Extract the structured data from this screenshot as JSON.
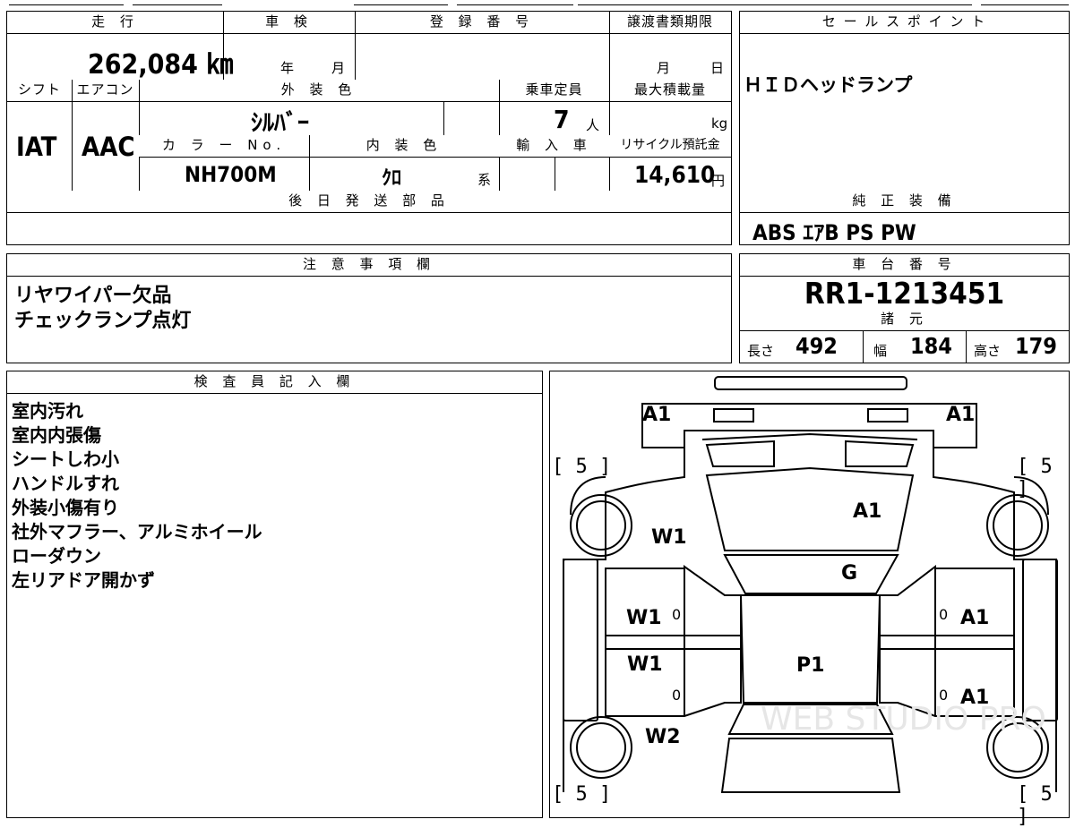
{
  "top_row": {
    "mileage_header": "走 行",
    "mileage_value": "262,084 ㎞",
    "shaken_header": "車 検",
    "shaken_year": "年",
    "shaken_month": "月",
    "reg_header": "登 録 番 号",
    "transfer_header": "譲渡書類期限",
    "transfer_month": "月",
    "transfer_day": "日"
  },
  "spec_row": {
    "shift_header": "シフト",
    "shift_value": "IAT",
    "ac_header": "エアコン",
    "ac_value": "AAC",
    "exterior_header": "外 装 色",
    "exterior_value": "ｼﾙﾊﾞｰ",
    "capacity_header": "乗車定員",
    "capacity_value": "7",
    "capacity_unit": "人",
    "loadmax_header": "最大積載量",
    "loadmax_unit": "kg",
    "colorno_header": "カ ラ ー No.",
    "colorno_value": "NH700M",
    "interior_header": "内 装 色",
    "interior_value": "ｸﾛ",
    "interior_suffix": "系",
    "import_header": "輸 入 車",
    "recycle_header": "リサイクル預託金",
    "recycle_value": "14,610",
    "recycle_unit": "円",
    "later_parts_header": "後 日 発 送 部 品"
  },
  "sales_point": {
    "header": "セ ー ル ス ポ イ ン ト",
    "text": "ＨＩＤヘッドランプ"
  },
  "genuine": {
    "header": "純 正 装 備",
    "text": "ABS ｴｱB PS PW"
  },
  "notes": {
    "header": "注 意 事 項 欄",
    "lines": [
      "リヤワイパー欠品",
      "チェックランプ点灯"
    ]
  },
  "chassis": {
    "header": "車 台 番 号",
    "value": "RR1-1213451",
    "specs_header": "諸 元",
    "length_label": "長さ",
    "length_value": "492",
    "width_label": "幅",
    "width_value": "184",
    "height_label": "高さ",
    "height_value": "179"
  },
  "inspector": {
    "header": "検 査 員 記 入 欄",
    "lines": [
      "室内汚れ",
      "室内内張傷",
      "シートしわ小",
      "ハンドルすれ",
      "外装小傷有り",
      "社外マフラー、アルミホイール",
      "ローダウン",
      "左リアドア開かず"
    ]
  },
  "diagram": {
    "a1_front_left": "A1",
    "a1_front_right": "A1",
    "a1_hood": "A1",
    "w1_windshield": "W1",
    "g_windshield": "G",
    "w1_front_door": "W1",
    "w1_rear_door": "W1",
    "a1_right_front_door": "A1",
    "a1_right_rear_door": "A1",
    "p1_roof": "P1",
    "w2_rear": "W2",
    "door_zero_1": "0",
    "door_zero_2": "0",
    "door_zero_3": "0",
    "door_zero_4": "0",
    "tire_fl": "[ 5 ]",
    "tire_fr": "[ 5 ]",
    "tire_rl": "[ 5 ]",
    "tire_rr": "[ 5 ]",
    "watermark": "WEB STUDIO PRO"
  }
}
